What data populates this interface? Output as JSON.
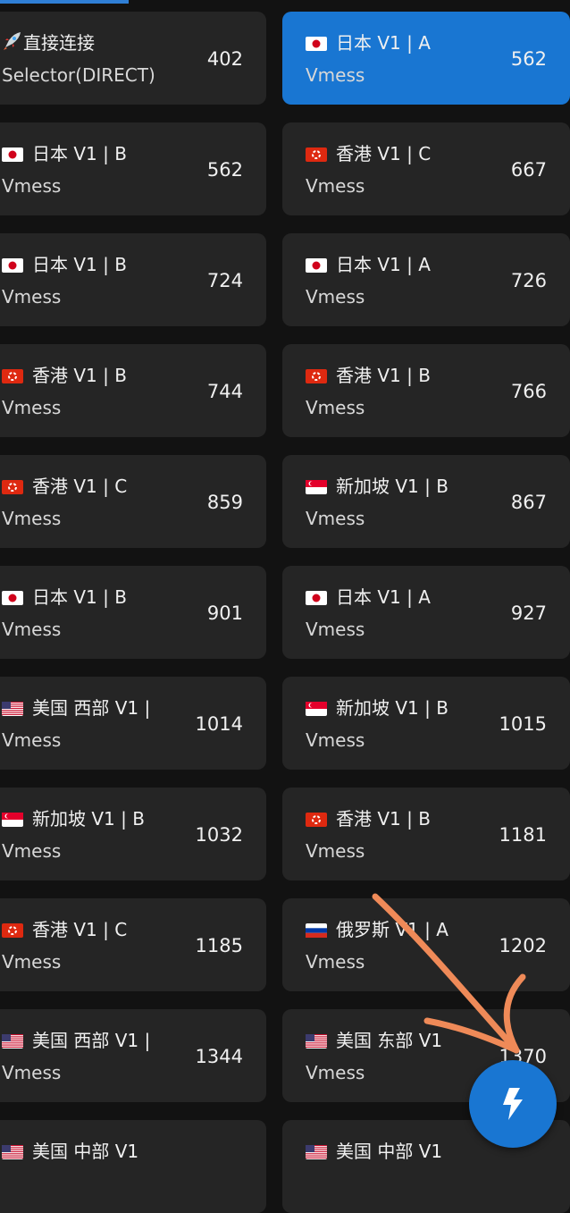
{
  "colors": {
    "accent": "#1976d2",
    "card": "#252525",
    "background": "#121212",
    "annotation": "#ef8a58"
  },
  "proxies": [
    {
      "column": "left",
      "flag": "rocket",
      "name": "直接连接",
      "type": "Selector(DIRECT)",
      "latency": "402",
      "selected": false
    },
    {
      "column": "right",
      "flag": "jp-flag",
      "name": "日本 V1 | A",
      "type": "Vmess",
      "latency": "562",
      "selected": true
    },
    {
      "column": "left",
      "flag": "jp-flag",
      "name": "日本 V1 | B",
      "type": "Vmess",
      "latency": "562",
      "selected": false
    },
    {
      "column": "right",
      "flag": "hk-flag",
      "name": "香港 V1 | C",
      "type": "Vmess",
      "latency": "667",
      "selected": false
    },
    {
      "column": "left",
      "flag": "jp-flag",
      "name": "日本 V1 | B",
      "type": "Vmess",
      "latency": "724",
      "selected": false
    },
    {
      "column": "right",
      "flag": "jp-flag",
      "name": "日本 V1 | A",
      "type": "Vmess",
      "latency": "726",
      "selected": false
    },
    {
      "column": "left",
      "flag": "hk-flag",
      "name": "香港 V1 | B",
      "type": "Vmess",
      "latency": "744",
      "selected": false
    },
    {
      "column": "right",
      "flag": "hk-flag",
      "name": "香港 V1 | B",
      "type": "Vmess",
      "latency": "766",
      "selected": false
    },
    {
      "column": "left",
      "flag": "hk-flag",
      "name": "香港 V1 | C",
      "type": "Vmess",
      "latency": "859",
      "selected": false
    },
    {
      "column": "right",
      "flag": "sg-flag",
      "name": "新加坡 V1 | B",
      "type": "Vmess",
      "latency": "867",
      "selected": false
    },
    {
      "column": "left",
      "flag": "jp-flag",
      "name": "日本 V1 | B",
      "type": "Vmess",
      "latency": "901",
      "selected": false
    },
    {
      "column": "right",
      "flag": "jp-flag",
      "name": "日本 V1 | A",
      "type": "Vmess",
      "latency": "927",
      "selected": false
    },
    {
      "column": "left",
      "flag": "us-flag",
      "name": "美国 西部 V1 |",
      "type": "Vmess",
      "latency": "1014",
      "selected": false
    },
    {
      "column": "right",
      "flag": "sg-flag",
      "name": "新加坡 V1 | B",
      "type": "Vmess",
      "latency": "1015",
      "selected": false
    },
    {
      "column": "left",
      "flag": "sg-flag",
      "name": "新加坡 V1 | B",
      "type": "Vmess",
      "latency": "1032",
      "selected": false
    },
    {
      "column": "right",
      "flag": "hk-flag",
      "name": "香港 V1 | B",
      "type": "Vmess",
      "latency": "1181",
      "selected": false
    },
    {
      "column": "left",
      "flag": "hk-flag",
      "name": "香港 V1 | C",
      "type": "Vmess",
      "latency": "1185",
      "selected": false
    },
    {
      "column": "right",
      "flag": "ru-flag",
      "name": "俄罗斯 V1 | A",
      "type": "Vmess",
      "latency": "1202",
      "selected": false
    },
    {
      "column": "left",
      "flag": "us-flag",
      "name": "美国 西部 V1 |",
      "type": "Vmess",
      "latency": "1344",
      "selected": false
    },
    {
      "column": "right",
      "flag": "us-flag",
      "name": "美国 东部 V1",
      "type": "Vmess",
      "latency": "1370",
      "selected": false
    },
    {
      "column": "left",
      "flag": "us-flag",
      "name": "美国 中部 V1",
      "type": "",
      "latency": "",
      "selected": false
    },
    {
      "column": "right",
      "flag": "us-flag",
      "name": "美国 中部 V1",
      "type": "",
      "latency": "",
      "selected": false
    }
  ],
  "fab": {
    "icon": "lightning-icon"
  },
  "annotation": {
    "icon": "hand-drawn-arrow-icon"
  }
}
